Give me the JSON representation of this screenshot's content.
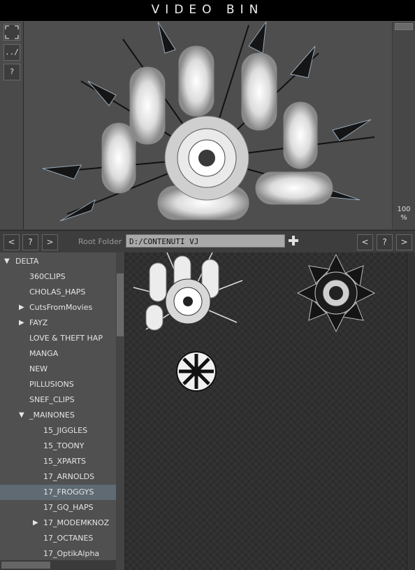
{
  "app": {
    "title": "VIDEO BIN"
  },
  "side_buttons": {
    "fullscreen_label": "",
    "up_label": "../",
    "help_label": "?"
  },
  "preview": {
    "zoom_value": "100",
    "zoom_unit": "%"
  },
  "nav": {
    "prev_label": "<",
    "help_label": "?",
    "next_label": ">",
    "root_folder_label": "Root Folder",
    "root_folder_value": "D:/CONTENUTI VJ",
    "add_label": "+"
  },
  "tree": {
    "items": [
      {
        "label": "DELTA",
        "arrow": "▼",
        "level": 0
      },
      {
        "label": "360CLIPS",
        "arrow": "",
        "level": 1
      },
      {
        "label": "CHOLAS_HAPS",
        "arrow": "",
        "level": 1
      },
      {
        "label": "CutsFromMovies",
        "arrow": "▶",
        "level": 1
      },
      {
        "label": "FAYZ",
        "arrow": "▶",
        "level": 1
      },
      {
        "label": "LOVE & THEFT HAP",
        "arrow": "",
        "level": 1
      },
      {
        "label": "MANGA",
        "arrow": "",
        "level": 1
      },
      {
        "label": "NEW",
        "arrow": "",
        "level": 1
      },
      {
        "label": "PILLUSIONS",
        "arrow": "",
        "level": 1
      },
      {
        "label": "SNEF_CLIPS",
        "arrow": "",
        "level": 1
      },
      {
        "label": "_MAINONES",
        "arrow": "▼",
        "level": 1
      },
      {
        "label": "15_JIGGLES",
        "arrow": "",
        "level": 2
      },
      {
        "label": "15_TOONY",
        "arrow": "",
        "level": 2
      },
      {
        "label": "15_XPARTS",
        "arrow": "",
        "level": 2
      },
      {
        "label": "17_ARNOLDS",
        "arrow": "",
        "level": 2
      },
      {
        "label": "17_FROGGYS",
        "arrow": "",
        "level": 2,
        "selected": true
      },
      {
        "label": "17_GQ_HAPS",
        "arrow": "",
        "level": 2
      },
      {
        "label": "17_MODEMKNOZ",
        "arrow": "▶",
        "level": 2
      },
      {
        "label": "17_OCTANES",
        "arrow": "",
        "level": 2
      },
      {
        "label": "17_OptikAlpha",
        "arrow": "",
        "level": 2
      }
    ]
  },
  "colors": {
    "selected_row": "#5f6a72",
    "title_bg": "#000000"
  }
}
